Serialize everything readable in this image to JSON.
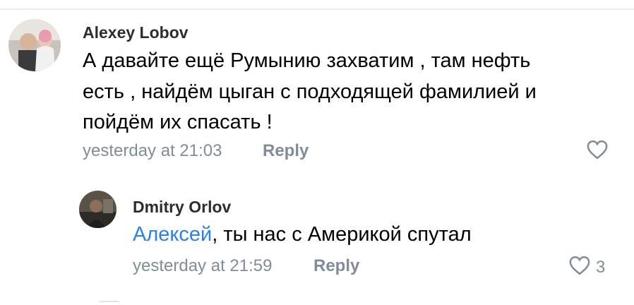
{
  "comments": [
    {
      "author": "Alexey Lobov",
      "lines": [
        "А давайте ещё Румынию захватим , там нефть",
        "есть , найдём цыган с подходящей фамилией и",
        "пойдём их спасать !"
      ],
      "timestamp": "yesterday at 21:03",
      "reply_label": "Reply",
      "like_icon": "heart-outline-icon",
      "like_count": ""
    },
    {
      "author": "Dmitry Orlov",
      "mention": "Алексей",
      "text": ", ты нас с Америкой спутал",
      "timestamp": "yesterday at 21:59",
      "reply_label": "Reply",
      "like_icon": "heart-outline-icon",
      "like_count": "3"
    }
  ],
  "colors": {
    "author": "#2c2d2e",
    "meta": "#818c99",
    "mention": "#2d81e0",
    "text": "#000000"
  }
}
